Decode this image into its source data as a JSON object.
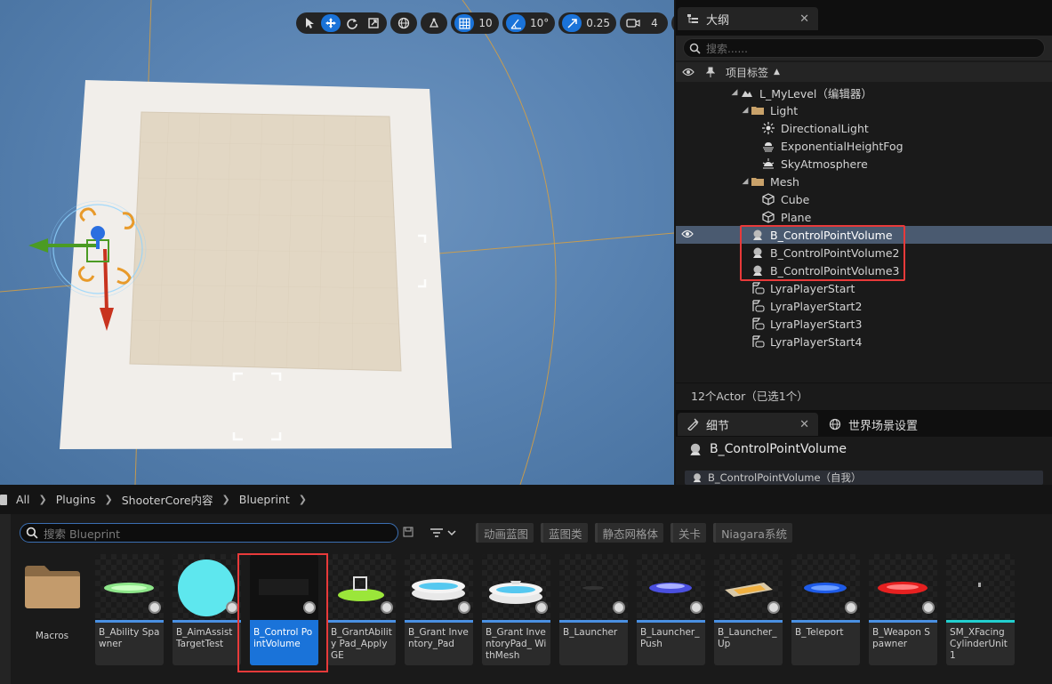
{
  "viewport": {
    "grid_snap": "10",
    "rotation_snap": "10°",
    "scale_snap": "0.25",
    "camera_speed": "4"
  },
  "outliner": {
    "tab_title": "大纲",
    "search_placeholder": "搜索......",
    "column_label": "项目标签",
    "tree": [
      {
        "label": "L_MyLevel（编辑器）",
        "icon": "level-icon"
      },
      {
        "label": "Light",
        "icon": "folder-icon"
      },
      {
        "label": "DirectionalLight",
        "icon": "directional-light-icon"
      },
      {
        "label": "ExponentialHeightFog",
        "icon": "fog-icon"
      },
      {
        "label": "SkyAtmosphere",
        "icon": "sky-atmosphere-icon"
      },
      {
        "label": "Mesh",
        "icon": "folder-icon"
      },
      {
        "label": "Cube",
        "icon": "static-mesh-icon"
      },
      {
        "label": "Plane",
        "icon": "static-mesh-icon"
      },
      {
        "label": "B_ControlPointVolume",
        "icon": "blueprint-actor-icon"
      },
      {
        "label": "B_ControlPointVolume2",
        "icon": "blueprint-actor-icon"
      },
      {
        "label": "B_ControlPointVolume3",
        "icon": "blueprint-actor-icon"
      },
      {
        "label": "LyraPlayerStart",
        "icon": "player-start-icon"
      },
      {
        "label": "LyraPlayerStart2",
        "icon": "player-start-icon"
      },
      {
        "label": "LyraPlayerStart3",
        "icon": "player-start-icon"
      },
      {
        "label": "LyraPlayerStart4",
        "icon": "player-start-icon"
      }
    ],
    "status": "12个Actor（已选1个）"
  },
  "details": {
    "tab_title": "细节",
    "world_settings_tab": "世界场景设置",
    "selected_actor": "B_ControlPointVolume",
    "component_row": "B_ControlPointVolume（自我）"
  },
  "content_browser": {
    "breadcrumb": [
      "All",
      "Plugins",
      "ShooterCore内容",
      "Blueprint"
    ],
    "search_placeholder": "搜索 Blueprint",
    "filters": [
      "动画蓝图",
      "蓝图类",
      "静态网格体",
      "关卡",
      "Niagara系统"
    ],
    "assets": [
      {
        "label": "Macros",
        "type": "folder"
      },
      {
        "label": "B_Ability Spawner",
        "type": "blueprint"
      },
      {
        "label": "B_AimAssist TargetTest",
        "type": "blueprint"
      },
      {
        "label": "B_Control PointVolume",
        "type": "blueprint"
      },
      {
        "label": "B_GrantAbility Pad_ApplyGE",
        "type": "blueprint"
      },
      {
        "label": "B_Grant Inventory_Pad",
        "type": "blueprint"
      },
      {
        "label": "B_Grant InventoryPad_ WithMesh",
        "type": "blueprint"
      },
      {
        "label": "B_Launcher",
        "type": "blueprint"
      },
      {
        "label": "B_Launcher_ Push",
        "type": "blueprint"
      },
      {
        "label": "B_Launcher_ Up",
        "type": "blueprint"
      },
      {
        "label": "B_Teleport",
        "type": "blueprint"
      },
      {
        "label": "B_Weapon Spawner",
        "type": "blueprint"
      },
      {
        "label": "SM_XFacing CylinderUnit1",
        "type": "static-mesh"
      }
    ]
  },
  "colors": {
    "accent": "#1a73d9",
    "selection_row": "#4a5a70",
    "highlight_box": "#e83a3a"
  }
}
